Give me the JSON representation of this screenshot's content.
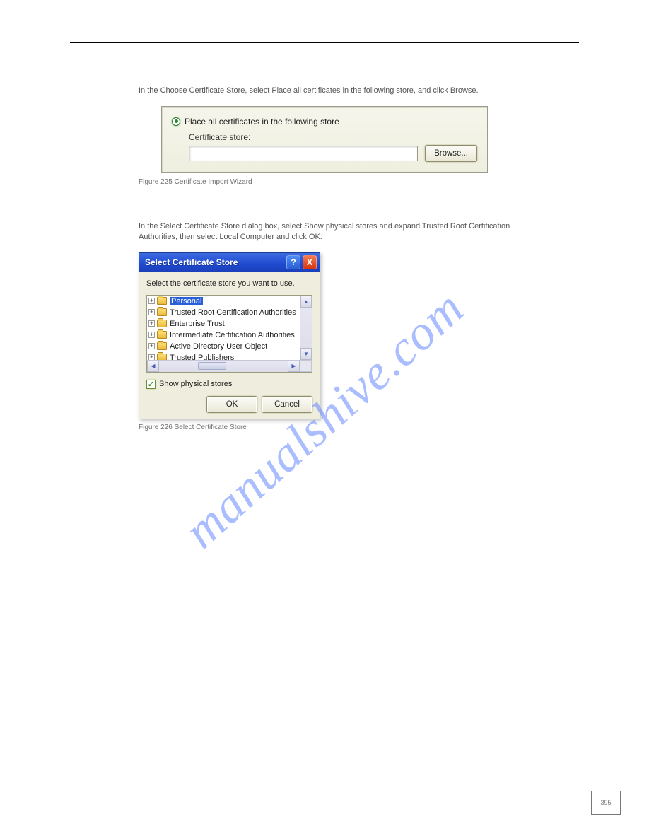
{
  "page": {
    "number": "395",
    "footer_left": "",
    "footer_right": ""
  },
  "watermark": "manualshive.com",
  "step1": {
    "text": "In the Choose Certificate Store, select Place all certificates in the following store, and click Browse."
  },
  "shot1": {
    "radio_label": "Place all certificates in the following store",
    "cert_store_label": "Certificate store:",
    "cert_store_value": "",
    "browse": "Browse..."
  },
  "fig1_caption": "Figure 225  Certificate Import Wizard",
  "step2": {
    "text": "In the Select Certificate Store dialog box, select Show physical stores and expand Trusted Root Certification Authorities, then select Local Computer and click OK."
  },
  "dlg": {
    "title": "Select Certificate Store",
    "help": "?",
    "close": "X",
    "msg": "Select the certificate store you want to use.",
    "tree": [
      {
        "label": "Personal",
        "selected": true
      },
      {
        "label": "Trusted Root Certification Authorities",
        "selected": false
      },
      {
        "label": "Enterprise Trust",
        "selected": false
      },
      {
        "label": "Intermediate Certification Authorities",
        "selected": false
      },
      {
        "label": "Active Directory User Object",
        "selected": false
      },
      {
        "label": "Trusted Publishers",
        "selected": false
      }
    ],
    "chk_label": "Show physical stores",
    "chk_checked": true,
    "ok": "OK",
    "cancel": "Cancel"
  },
  "fig2_caption": "Figure 226  Select Certificate Store"
}
